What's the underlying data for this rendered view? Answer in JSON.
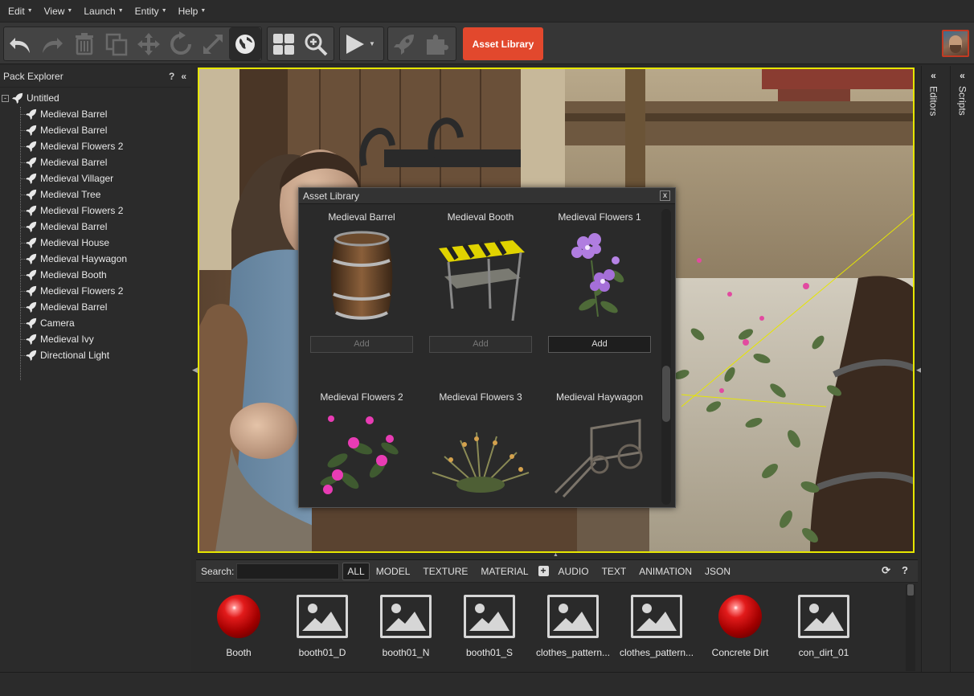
{
  "menu": [
    {
      "label": "Edit"
    },
    {
      "label": "View"
    },
    {
      "label": "Launch"
    },
    {
      "label": "Entity"
    },
    {
      "label": "Help"
    }
  ],
  "toolbar": {
    "asset_library_label": "Asset Library",
    "icons": [
      "undo-icon",
      "redo-icon",
      "delete-icon",
      "duplicate-icon",
      "move-icon",
      "rotate-icon",
      "scale-icon",
      "world-space-icon",
      "grid-icon",
      "zoom-icon",
      "play-icon",
      "publish-icon",
      "puzzle-icon"
    ]
  },
  "pack_explorer": {
    "title": "Pack Explorer",
    "help": "?",
    "collapse": "«",
    "root": {
      "label": "Untitled",
      "expander": "-"
    },
    "items": [
      "Medieval Barrel",
      "Medieval Barrel",
      "Medieval Flowers 2",
      "Medieval Barrel",
      "Medieval Villager",
      "Medieval Tree",
      "Medieval Flowers 2",
      "Medieval Barrel",
      "Medieval House",
      "Medieval Haywagon",
      "Medieval Booth",
      "Medieval Flowers 2",
      "Medieval Barrel",
      "Camera",
      "Medieval Ivy",
      "Directional Light"
    ]
  },
  "right_tabs": {
    "editors": {
      "label": "Editors",
      "chev": "«"
    },
    "scripts": {
      "label": "Scripts",
      "chev": "«"
    }
  },
  "asset_dialog": {
    "title": "Asset Library",
    "close": "x",
    "assets": [
      {
        "name": "Medieval Barrel",
        "add": "Add",
        "enabled": false
      },
      {
        "name": "Medieval Booth",
        "add": "Add",
        "enabled": false
      },
      {
        "name": "Medieval Flowers 1",
        "add": "Add",
        "enabled": true
      },
      {
        "name": "Medieval Flowers 2"
      },
      {
        "name": "Medieval Flowers 3"
      },
      {
        "name": "Medieval Haywagon"
      }
    ]
  },
  "browser": {
    "search_label": "Search:",
    "search_value": "",
    "filters": [
      "ALL",
      "MODEL",
      "TEXTURE",
      "MATERIAL",
      "AUDIO",
      "TEXT",
      "ANIMATION",
      "JSON"
    ],
    "refresh": "⟳",
    "help": "?",
    "assets": [
      {
        "label": "Booth",
        "type": "material"
      },
      {
        "label": "booth01_D",
        "type": "texture"
      },
      {
        "label": "booth01_N",
        "type": "texture"
      },
      {
        "label": "booth01_S",
        "type": "texture"
      },
      {
        "label": "clothes_pattern...",
        "type": "texture"
      },
      {
        "label": "clothes_pattern...",
        "type": "texture"
      },
      {
        "label": "Concrete Dirt",
        "type": "material"
      },
      {
        "label": "con_dirt_01",
        "type": "texture"
      }
    ]
  },
  "colors": {
    "accent": "#e2482d",
    "viewport_border": "#e6e600"
  }
}
